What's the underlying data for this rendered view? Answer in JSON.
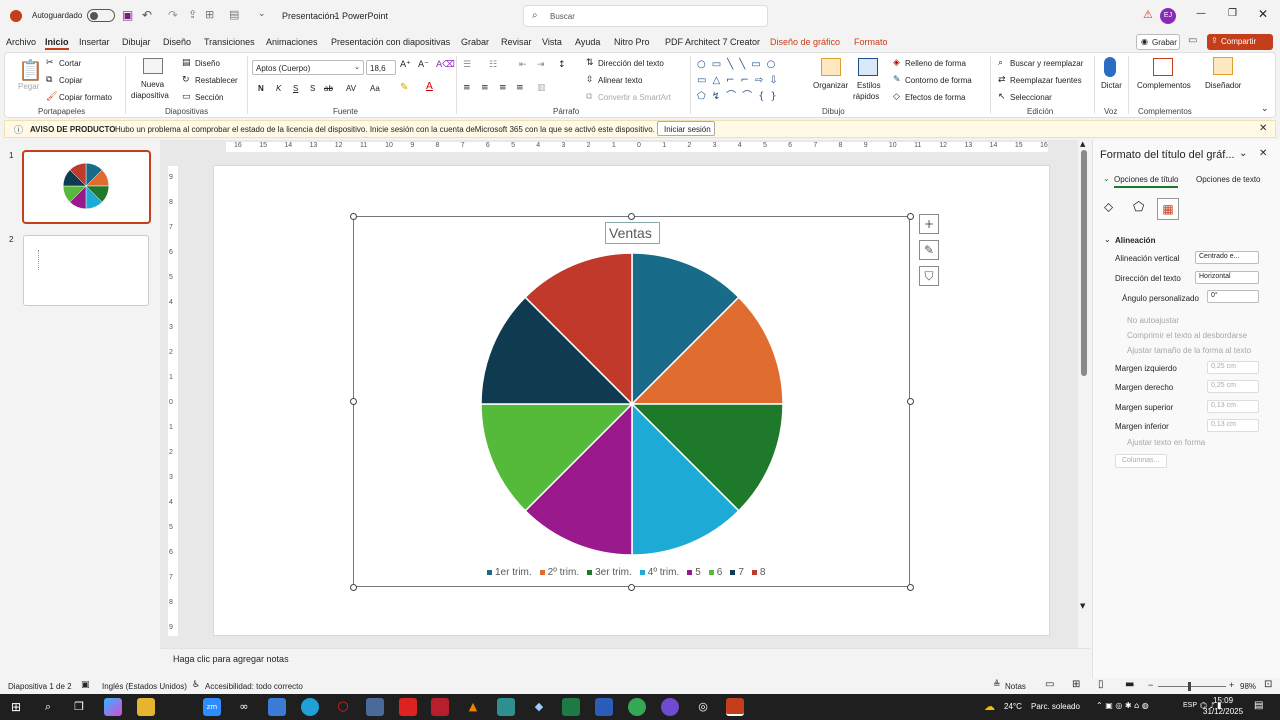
{
  "titlebar": {
    "autosave": "Autoguardado",
    "doc_title": "Presentación1",
    "separator": "-",
    "app": "PowerPoint",
    "search_placeholder": "Buscar",
    "avatar": "EJ"
  },
  "tabs": [
    "Archivo",
    "Inicio",
    "Insertar",
    "Dibujar",
    "Diseño",
    "Transiciones",
    "Animaciones",
    "Presentación con diapositivas",
    "Grabar",
    "Revisar",
    "Vista",
    "Ayuda",
    "Nitro Pro",
    "PDF Architect 7 Creator",
    "Diseño de gráfico",
    "Formato"
  ],
  "tab_actions": {
    "grabar": "Grabar",
    "compartir": "Compartir"
  },
  "ribbon": {
    "clipboard": {
      "paste": "Pegar",
      "cut": "Cortar",
      "copy": "Copiar",
      "format_painter": "Copiar formato",
      "label": "Portapapeles"
    },
    "slides": {
      "new_slide_1": "Nueva",
      "new_slide_2": "diapositiva",
      "layout": "Diseño",
      "reset": "Restablecer",
      "section": "Sección",
      "label": "Diapositivas"
    },
    "font": {
      "name": "Aptos (Cuerpo)",
      "size": "18,6",
      "bold": "N",
      "italic": "K",
      "underline": "S",
      "shadow": "S",
      "strike": "ab",
      "spacing": "AV",
      "case": "Aa",
      "label": "Fuente"
    },
    "paragraph": {
      "text_direction": "Dirección del texto",
      "align_text": "Alinear texto",
      "smartart": "Convertir a SmartArt",
      "label": "Párrafo"
    },
    "drawing": {
      "arrange": "Organizar",
      "quick_styles_1": "Estilos",
      "quick_styles_2": "rápidos",
      "shape_fill": "Relleno de forma",
      "shape_outline": "Contorno de forma",
      "shape_effects": "Efectos de forma",
      "label": "Dibujo"
    },
    "editing": {
      "find": "Buscar y reemplazar",
      "replace_fonts": "Reemplazar fuentes",
      "select": "Seleccionar",
      "label": "Edición"
    },
    "voice": {
      "dictate": "Dictar",
      "label": "Voz"
    },
    "addins": {
      "addins": "Complementos",
      "designer": "Diseñador",
      "label": "Complementos"
    }
  },
  "notice": {
    "title": "AVISO DE PRODUCTO",
    "message": "Hubo un problema al comprobar el estado de la licencia del dispositivo. Inicie sesión con la cuenta deMicrosoft 365 con la que se activó este dispositivo.",
    "button": "Iniciar sesión"
  },
  "thumbnails": [
    {
      "num": "1"
    },
    {
      "num": "2"
    }
  ],
  "ruler": {
    "h": [
      "16",
      "15",
      "14",
      "13",
      "12",
      "11",
      "10",
      "9",
      "8",
      "7",
      "6",
      "5",
      "4",
      "3",
      "2",
      "1",
      "0",
      "1",
      "2",
      "3",
      "4",
      "5",
      "6",
      "7",
      "8",
      "9",
      "10",
      "11",
      "12",
      "13",
      "14",
      "15",
      "16"
    ],
    "v": [
      "9",
      "8",
      "7",
      "6",
      "5",
      "4",
      "3",
      "2",
      "1",
      "0",
      "1",
      "2",
      "3",
      "4",
      "5",
      "6",
      "7",
      "8",
      "9"
    ]
  },
  "chart_data": {
    "type": "pie",
    "title": "Ventas",
    "categories": [
      "1er trim.",
      "2º trim.",
      "3er trim.",
      "4º trim.",
      "5",
      "6",
      "7",
      "8"
    ],
    "values": [
      1,
      1,
      1,
      1,
      1,
      1,
      1,
      1
    ],
    "colors": [
      "#196b8a",
      "#e06c2f",
      "#1e7a2a",
      "#1eaad6",
      "#9a1a8e",
      "#55b93a",
      "#0e3b4f",
      "#c0392b"
    ],
    "legend": "bottom"
  },
  "pane": {
    "title": "Formato del título del gráf...",
    "tab1": "Opciones de título",
    "tab2": "Opciones de texto",
    "section": "Alineación",
    "valign_label": "Alineación vertical",
    "valign_value": "Centrado e...",
    "dir_label": "Dirección del texto",
    "dir_value": "Horizontal",
    "angle_label": "Ángulo personalizado",
    "angle_value": "0°",
    "opt_noauto": "No autoajustar",
    "opt_shrink": "Comprimir el texto al desbordarse",
    "opt_resize": "Ajustar tamaño de la forma al texto",
    "ml_label": "Margen izquierdo",
    "ml_value": "0,25 cm",
    "mr_label": "Margen derecho",
    "mr_value": "0,25 cm",
    "mt_label": "Margen superior",
    "mt_value": "0,13 cm",
    "mb_label": "Margen inferior",
    "mb_value": "0,13 cm",
    "wrap": "Ajustar texto en forma",
    "columns": "Columnas..."
  },
  "notes_placeholder": "Haga clic para agregar notas",
  "status": {
    "slide": "Diapositiva 1 de 2",
    "lang": "Inglés (Estados Unidos)",
    "access": "Accesibilidad: todo correcto",
    "notes": "Notas",
    "zoom": "98%"
  },
  "taskbar": {
    "weather": "24°C",
    "weather_desc": "Parc. soleado",
    "lang": "ESP",
    "time": "15:09",
    "date": "31/12/2025"
  }
}
